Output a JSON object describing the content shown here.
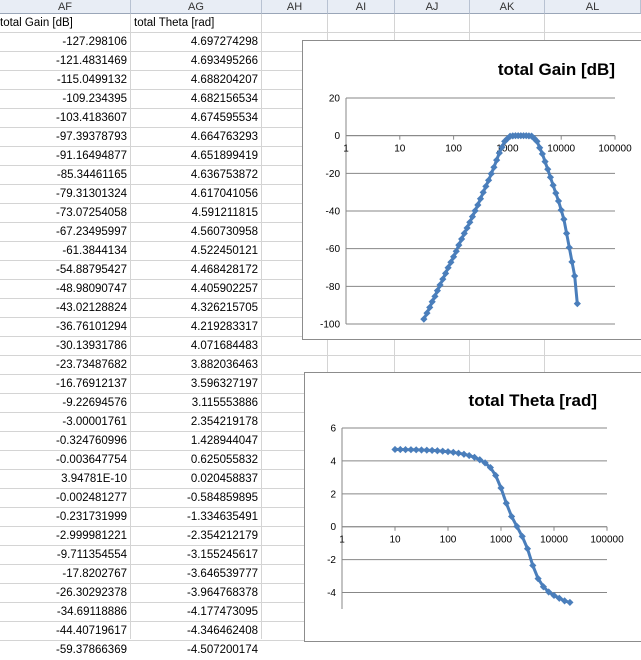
{
  "columns": [
    "AF",
    "AG",
    "AH",
    "AI",
    "AJ",
    "AK",
    "AL"
  ],
  "table": {
    "headers": [
      "total Gain [dB]",
      "total Theta [rad]"
    ],
    "rows": [
      [
        "-127.298106",
        "4.697274298"
      ],
      [
        "-121.4831469",
        "4.693495266"
      ],
      [
        "-115.0499132",
        "4.688204207"
      ],
      [
        "-109.234395",
        "4.682156534"
      ],
      [
        "-103.4183607",
        "4.674595534"
      ],
      [
        "-97.39378793",
        "4.664763293"
      ],
      [
        "-91.16494877",
        "4.651899419"
      ],
      [
        "-85.34461165",
        "4.636753872"
      ],
      [
        "-79.31301324",
        "4.617041056"
      ],
      [
        "-73.07254058",
        "4.591211815"
      ],
      [
        "-67.23495997",
        "4.560730958"
      ],
      [
        "-61.3844134",
        "4.522450121"
      ],
      [
        "-54.88795427",
        "4.468428172"
      ],
      [
        "-48.98090747",
        "4.405902257"
      ],
      [
        "-43.02128824",
        "4.326215705"
      ],
      [
        "-36.76101294",
        "4.219283317"
      ],
      [
        "-30.13931786",
        "4.071684483"
      ],
      [
        "-23.73487682",
        "3.882036463"
      ],
      [
        "-16.76912137",
        "3.596327197"
      ],
      [
        "-9.22694576",
        "3.115553886"
      ],
      [
        "-3.00001761",
        "2.354219178"
      ],
      [
        "-0.324760996",
        "1.428944047"
      ],
      [
        "-0.003647754",
        "0.625055832"
      ],
      [
        "3.94781E-10",
        "0.020458837"
      ],
      [
        "-0.002481277",
        "-0.584859895"
      ],
      [
        "-0.231731999",
        "-1.334635491"
      ],
      [
        "-2.999981221",
        "-2.354212179"
      ],
      [
        "-9.711354554",
        "-3.155245617"
      ],
      [
        "-17.8202767",
        "-3.646539777"
      ],
      [
        "-26.30292378",
        "-3.964768378"
      ],
      [
        "-34.69118886",
        "-4.177473095"
      ],
      [
        "-44.40719617",
        "-4.346462408"
      ],
      [
        "-59.37866369",
        "-4.507200174"
      ]
    ]
  },
  "chart_data": [
    {
      "type": "scatter",
      "title": "total Gain [dB]",
      "x_scale": "log",
      "xlim": [
        1,
        100000
      ],
      "ylim": [
        -100,
        20
      ],
      "x_ticks": [
        "1",
        "10",
        "100",
        "1000",
        "10000",
        "100000"
      ],
      "y_ticks": [
        "20",
        "0",
        "-20",
        "-40",
        "-60",
        "-80",
        "-100"
      ],
      "color": "#4a7ebb",
      "x": [
        28,
        32,
        36,
        40,
        45,
        50,
        56,
        63,
        71,
        79,
        89,
        100,
        112,
        125,
        141,
        158,
        178,
        200,
        224,
        251,
        282,
        316,
        355,
        398,
        447,
        501,
        562,
        631,
        708,
        794,
        891,
        1000,
        1122,
        1259,
        1413,
        1585,
        1778,
        1995,
        2239,
        2512,
        2818,
        3162,
        3548,
        3981,
        4467,
        5012,
        5623,
        6310,
        7079,
        7943,
        8913,
        10000,
        11220,
        12589,
        14125,
        15849,
        17783,
        19953
      ],
      "y": [
        -97.4,
        -94.2,
        -91.2,
        -88.2,
        -85.3,
        -82.3,
        -79.3,
        -76.2,
        -73.1,
        -70.1,
        -67.2,
        -64.3,
        -61.4,
        -58.1,
        -54.9,
        -51.9,
        -49.0,
        -46.0,
        -43.0,
        -39.9,
        -36.8,
        -33.5,
        -30.1,
        -26.9,
        -23.7,
        -20.2,
        -16.8,
        -13.0,
        -9.2,
        -6.1,
        -3.0,
        -1.6,
        -0.3,
        -0.1,
        -0.004,
        0.0,
        0.0,
        0.0,
        -0.002,
        -0.1,
        -0.23,
        -1.5,
        -3.0,
        -6.4,
        -9.7,
        -13.8,
        -17.8,
        -22.1,
        -26.3,
        -30.5,
        -34.7,
        -39.5,
        -44.4,
        -51.9,
        -59.4,
        -67.0,
        -74.5,
        -89.2
      ]
    },
    {
      "type": "scatter",
      "title": "total Theta [rad]",
      "x_scale": "log",
      "xlim": [
        1,
        100000
      ],
      "ylim": [
        -5,
        6
      ],
      "x_ticks": [
        "1",
        "10",
        "100",
        "1000",
        "10000",
        "100000"
      ],
      "y_ticks": [
        "6",
        "4",
        "2",
        "0",
        "-2",
        "-4"
      ],
      "color": "#4a7ebb",
      "x": [
        10,
        12.6,
        15.8,
        20,
        25.1,
        31.6,
        39.8,
        50.1,
        63.1,
        79.4,
        100,
        126,
        158,
        200,
        251,
        316,
        398,
        501,
        631,
        794,
        1000,
        1259,
        1585,
        1995,
        2512,
        3162,
        3981,
        5012,
        6310,
        7943,
        10000,
        12589,
        15849,
        19953
      ],
      "y": [
        4.697,
        4.693,
        4.688,
        4.682,
        4.675,
        4.665,
        4.652,
        4.637,
        4.617,
        4.591,
        4.561,
        4.522,
        4.468,
        4.406,
        4.326,
        4.219,
        4.072,
        3.882,
        3.596,
        3.116,
        2.354,
        1.429,
        0.625,
        0.02,
        -0.585,
        -1.335,
        -2.354,
        -3.155,
        -3.647,
        -3.965,
        -4.177,
        -4.346,
        -4.507,
        -4.6
      ]
    }
  ]
}
